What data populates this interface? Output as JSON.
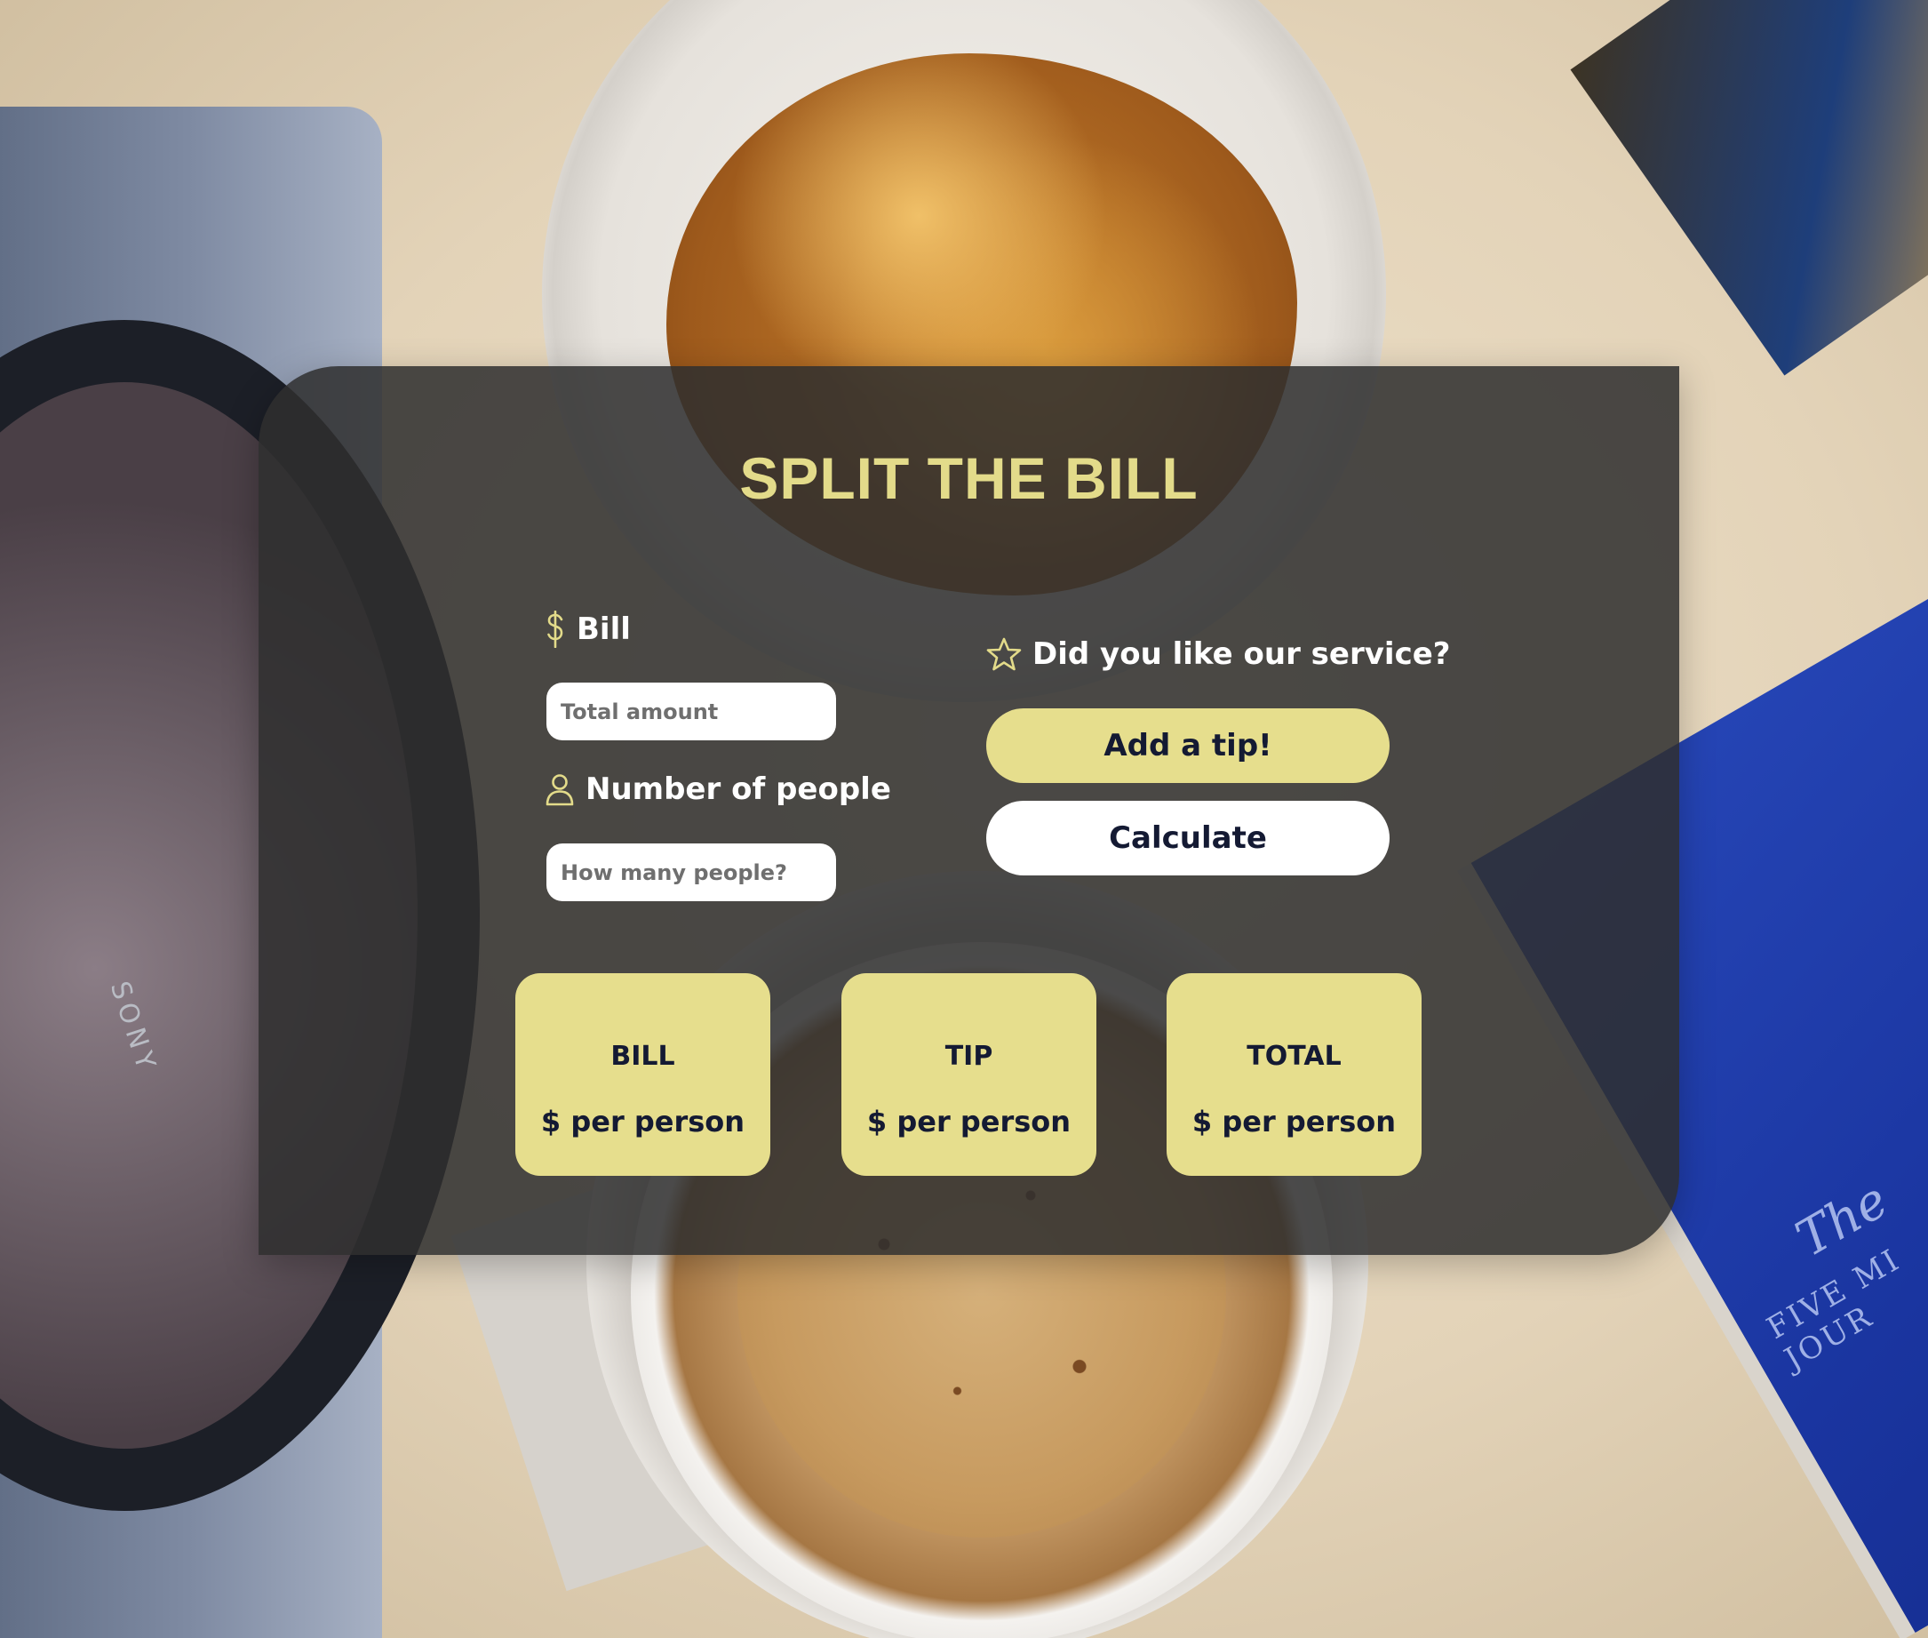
{
  "title": "SPLIT THE BILL",
  "bill": {
    "label": "Bill",
    "icon": "dollar-icon",
    "placeholder": "Total amount"
  },
  "people": {
    "label": "Number of people",
    "icon": "person-icon",
    "placeholder": "How many people?"
  },
  "service": {
    "label": "Did you like our service?",
    "icon": "star-icon"
  },
  "buttons": {
    "tip": "Add a tip!",
    "calculate": "Calculate"
  },
  "results": [
    {
      "title": "BILL",
      "value": "$ per person"
    },
    {
      "title": "TIP",
      "value": "$ per person"
    },
    {
      "title": "TOTAL",
      "value": "$ per person"
    }
  ],
  "background": {
    "headphones_brand": "SONY",
    "book_title": "The",
    "book_subtitle": "FIVE MI JOUR"
  },
  "colors": {
    "accent": "#e3db8a",
    "panel": "#2e2e2e",
    "button_text": "#141a33"
  }
}
